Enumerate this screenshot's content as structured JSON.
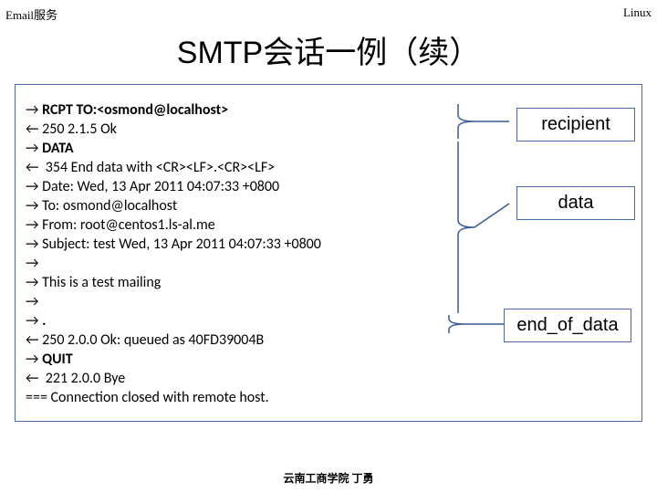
{
  "header": {
    "left": "Email服务",
    "right": "Linux"
  },
  "title": "SMTP会话一例（续）",
  "labels": {
    "recipient": "recipient",
    "data": "data",
    "end": "end_of_data"
  },
  "code": {
    "l1_pre": "→ ",
    "l1_bold": "RCPT TO:<osmond@localhost>",
    "l2": "← 250 2.1.5 Ok",
    "l3_pre": "→ ",
    "l3_bold": "DATA",
    "l4": "←  354 End data with <CR><LF>.<CR><LF>",
    "l5": "→ Date: Wed, 13 Apr 2011 04:07:33 +0800",
    "l6": "→ To: osmond@localhost",
    "l7": "→ From: root@centos1.ls-al.me",
    "l8": "→ Subject: test Wed, 13 Apr 2011 04:07:33 +0800",
    "l9": "→",
    "l10": "→ This is a test mailing",
    "l11": "→",
    "l12_pre": "→ ",
    "l12_bold": ".",
    "l13": "← 250 2.0.0 Ok: queued as 40FD39004B",
    "l14_pre": "→ ",
    "l14_bold": "QUIT",
    "l15": "←  221 2.0.0 Bye",
    "l16": "=== Connection closed with remote host."
  },
  "footer": "云南工商学院       丁勇"
}
